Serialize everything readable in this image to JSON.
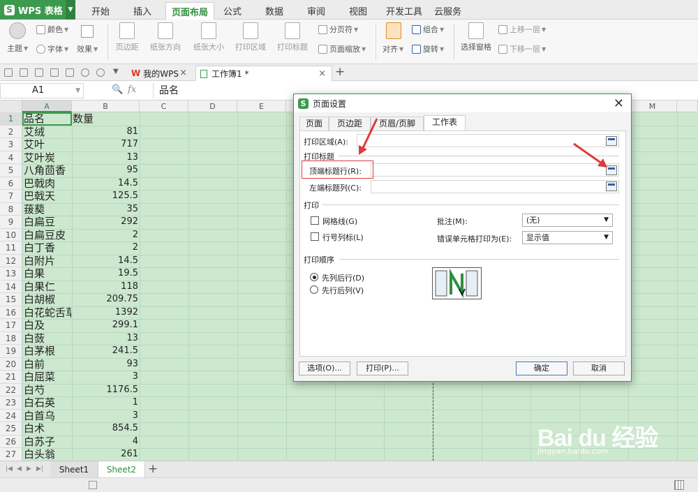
{
  "app": {
    "logo_text": "WPS 表格"
  },
  "menu": {
    "tabs": [
      "开始",
      "插入",
      "页面布局",
      "公式",
      "数据",
      "审阅",
      "视图",
      "开发工具",
      "云服务"
    ],
    "active": "页面布局"
  },
  "ribbon": {
    "theme": "主题",
    "colors": "颜色",
    "font": "字体",
    "effects": "效果",
    "margins": "页边距",
    "orientation": "纸张方向",
    "size": "纸张大小",
    "print_area": "打印区域",
    "print_titles": "打印标题",
    "page_break": "分页符",
    "page_zoom": "页面缩放",
    "align": "对齐",
    "group": "组合",
    "rotate": "旋转",
    "selection_pane": "选择窗格",
    "bring_forward": "上移一层",
    "send_backward": "下移一层"
  },
  "doc_tabs": [
    {
      "label": "我的WPS"
    },
    {
      "label": "工作簿1 *"
    }
  ],
  "formula_bar": {
    "cell_ref": "A1",
    "fx": "fx",
    "value": "品名"
  },
  "columns": [
    "A",
    "B",
    "C",
    "D",
    "E",
    "M"
  ],
  "rows": [
    {
      "n": "1",
      "a": "品名",
      "b": "数量"
    },
    {
      "n": "2",
      "a": "艾绒",
      "b": "81"
    },
    {
      "n": "3",
      "a": "艾叶",
      "b": "717"
    },
    {
      "n": "4",
      "a": "艾叶炭",
      "b": "13"
    },
    {
      "n": "5",
      "a": "八角茴香",
      "b": "95"
    },
    {
      "n": "6",
      "a": "巴戟肉",
      "b": "14.5"
    },
    {
      "n": "7",
      "a": "巴戟天",
      "b": "125.5"
    },
    {
      "n": "8",
      "a": "菝葜",
      "b": "35"
    },
    {
      "n": "9",
      "a": "白扁豆",
      "b": "292"
    },
    {
      "n": "10",
      "a": "白扁豆皮",
      "b": "2"
    },
    {
      "n": "11",
      "a": "白丁香",
      "b": "2"
    },
    {
      "n": "12",
      "a": "白附片",
      "b": "14.5"
    },
    {
      "n": "13",
      "a": "白果",
      "b": "19.5"
    },
    {
      "n": "14",
      "a": "白果仁",
      "b": "118"
    },
    {
      "n": "15",
      "a": "白胡椒",
      "b": "209.75"
    },
    {
      "n": "16",
      "a": "白花蛇舌草",
      "b": "1392"
    },
    {
      "n": "17",
      "a": "白及",
      "b": "299.1"
    },
    {
      "n": "18",
      "a": "白蔹",
      "b": "13"
    },
    {
      "n": "19",
      "a": "白茅根",
      "b": "241.5"
    },
    {
      "n": "20",
      "a": "白前",
      "b": "93"
    },
    {
      "n": "21",
      "a": "白屈菜",
      "b": "3"
    },
    {
      "n": "22",
      "a": "白芍",
      "b": "1176.5"
    },
    {
      "n": "23",
      "a": "白石英",
      "b": "1"
    },
    {
      "n": "24",
      "a": "白首乌",
      "b": "3"
    },
    {
      "n": "25",
      "a": "白术",
      "b": "854.5"
    },
    {
      "n": "26",
      "a": "白苏子",
      "b": "4"
    },
    {
      "n": "27",
      "a": "白头翁",
      "b": "261"
    }
  ],
  "sheet_tabs": [
    "Sheet1",
    "Sheet2"
  ],
  "active_sheet": "Sheet2",
  "dialog": {
    "title": "页面设置",
    "tabs": [
      "页面",
      "页边距",
      "页眉/页脚",
      "工作表"
    ],
    "active_tab": "工作表",
    "print_area_label": "打印区域(A):",
    "print_titles_section": "打印标题",
    "top_rows_label": "顶端标题行(R):",
    "left_cols_label": "左端标题列(C):",
    "print_section": "打印",
    "gridlines_label": "网格线(G)",
    "row_col_headers_label": "行号列标(L)",
    "comments_label": "批注(M):",
    "comments_value": "(无)",
    "cell_errors_label": "错误单元格打印为(E):",
    "cell_errors_value": "显示值",
    "order_section": "打印顺序",
    "down_then_over": "先列后行(D)",
    "over_then_down": "先行后列(V)",
    "options_btn": "选项(O)...",
    "print_btn": "打印(P)...",
    "ok_btn": "确定",
    "cancel_btn": "取消"
  },
  "watermark": {
    "main": "Bai du 经验",
    "sub": "jingyan.baidu.com"
  },
  "colors": {
    "accent": "#3c9a4e",
    "sheet_bg": "#cce8cf",
    "annotation": "#e03a3a"
  }
}
